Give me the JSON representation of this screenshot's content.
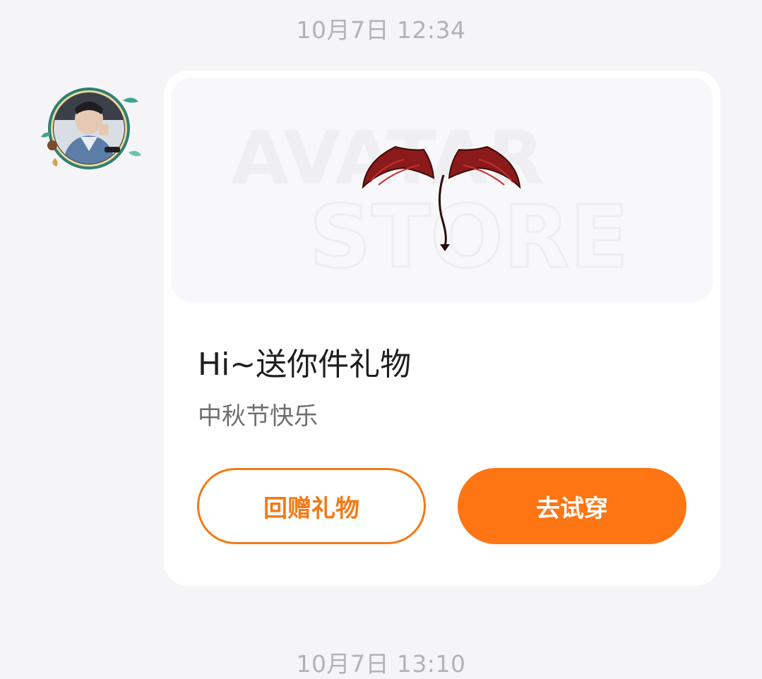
{
  "chat": {
    "timestamp_top": "10月7日 12:34",
    "timestamp_bottom": "10月7日 13:10"
  },
  "gift_card": {
    "preview": {
      "watermark_line1": "AVATAR",
      "watermark_line2": "STORE",
      "item_icon": "devil-wings-tail-icon"
    },
    "title": "Hi~送你件礼物",
    "message": "中秋节快乐",
    "buttons": {
      "return_gift": "回赠礼物",
      "try_on": "去试穿"
    }
  },
  "colors": {
    "accent_orange": "#fd7613",
    "outline_orange": "#f47a16",
    "background": "#f5f5f7",
    "card": "#ffffff",
    "timestamp_gray": "#b3b3b6"
  }
}
